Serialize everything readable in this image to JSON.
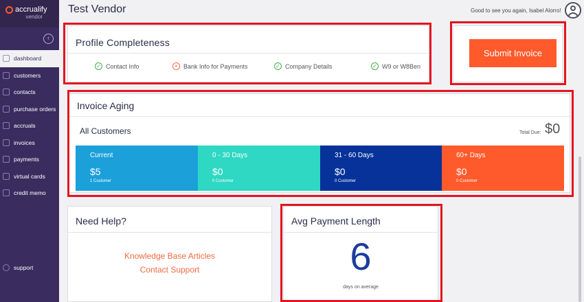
{
  "brand": {
    "name": "accrualify",
    "sub": "vendor"
  },
  "sidebar": {
    "collapse_icon": "chevron-left-icon",
    "items": [
      {
        "label": "dashboard",
        "icon": "home-icon",
        "active": true
      },
      {
        "label": "customers",
        "icon": "people-icon"
      },
      {
        "label": "contacts",
        "icon": "contacts-icon"
      },
      {
        "label": "purchase orders",
        "icon": "cart-icon"
      },
      {
        "label": "accruals",
        "icon": "accruals-icon"
      },
      {
        "label": "invoices",
        "icon": "invoice-icon"
      },
      {
        "label": "payments",
        "icon": "payments-icon"
      },
      {
        "label": "virtual cards",
        "icon": "card-icon"
      },
      {
        "label": "credit memo",
        "icon": "memo-icon"
      }
    ],
    "support": "support"
  },
  "header": {
    "title": "Test Vendor",
    "greeting": "Good to see you again, Isabel Alorro!"
  },
  "profile": {
    "title": "Profile Completeness",
    "items": [
      {
        "label": "Contact Info",
        "status": "complete"
      },
      {
        "label": "Bank Info for Payments",
        "status": "incomplete"
      },
      {
        "label": "Company Details",
        "status": "complete"
      },
      {
        "label": "W9 or W8Ben",
        "status": "complete"
      }
    ]
  },
  "submit": {
    "label": "Submit Invoice"
  },
  "aging": {
    "title": "Invoice Aging",
    "subtitle": "All Customers",
    "total_label": "Total Due:",
    "total_value": "$0",
    "buckets": [
      {
        "label": "Current",
        "amount": "$5",
        "count": "1 Customer",
        "color": "#1ba0da"
      },
      {
        "label": "0 - 30 Days",
        "amount": "$0",
        "count": "0 Customer",
        "color": "#2ed8c3"
      },
      {
        "label": "31 - 60 Days",
        "amount": "$0",
        "count": "0 Customer",
        "color": "#06329a"
      },
      {
        "label": "60+ Days",
        "amount": "$0",
        "count": "0 Customer",
        "color": "#ff5a2c"
      }
    ]
  },
  "help": {
    "title": "Need Help?",
    "links": [
      "Knowledge Base Articles",
      "Contact Support"
    ]
  },
  "avg": {
    "title": "Avg Payment Length",
    "value": "6",
    "sub": "days on average"
  },
  "colors": {
    "accent": "#ff5a2c",
    "sidebar": "#3a2c5e",
    "highlight": "#e4141e"
  }
}
